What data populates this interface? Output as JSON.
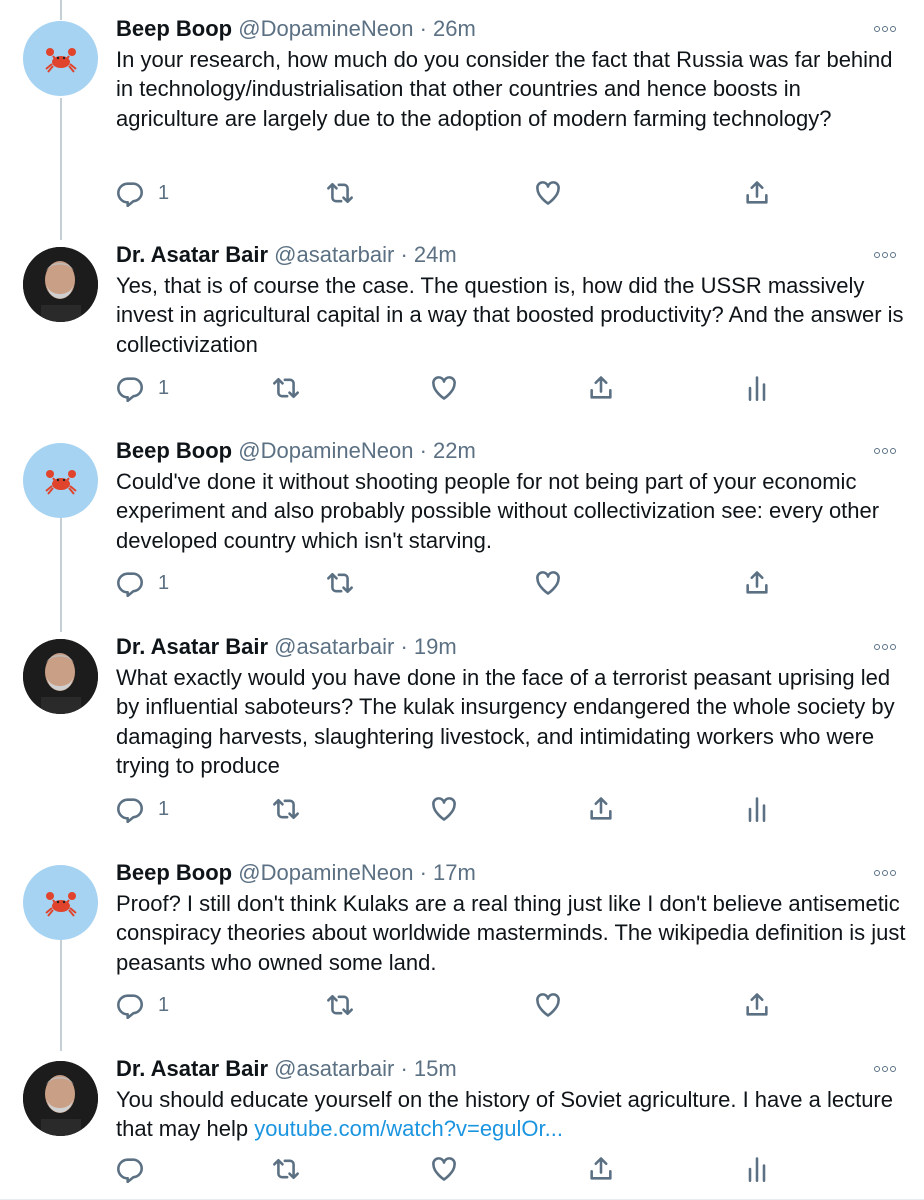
{
  "tweets": [
    {
      "name": "Beep Boop",
      "handle": "@DopamineNeon",
      "dot": "·",
      "time": "26m",
      "avatar": "crab-emoji-avatar",
      "text": "In your research, how much do you consider the fact that Russia was far behind in technology/industrialisation that other countries and hence boosts in agriculture are largely due to the adoption of modern farming technology?",
      "reply_count": "1"
    },
    {
      "name": "Dr. Asatar Bair",
      "handle": "@asatarbair",
      "dot": "·",
      "time": "24m",
      "avatar": "person-photo-avatar",
      "text": "Yes, that is of course the case. The question is, how did the USSR massively invest in agricultural capital in a way that boosted productivity? And the answer is collectivization",
      "reply_count": "1"
    },
    {
      "name": "Beep Boop",
      "handle": "@DopamineNeon",
      "dot": "·",
      "time": "22m",
      "avatar": "crab-emoji-avatar",
      "text": "Could've done it without shooting people for not being part of your economic experiment and also probably possible without collectivization see: every other developed country which isn't starving.",
      "reply_count": "1"
    },
    {
      "name": "Dr. Asatar Bair",
      "handle": "@asatarbair",
      "dot": "·",
      "time": "19m",
      "avatar": "person-photo-avatar",
      "text": "What exactly would you have done in the face of a terrorist peasant uprising led by influential saboteurs? The kulak insurgency endangered the whole society by damaging harvests, slaughtering livestock, and intimidating workers who were trying to produce",
      "reply_count": "1"
    },
    {
      "name": "Beep Boop",
      "handle": "@DopamineNeon",
      "dot": "·",
      "time": "17m",
      "avatar": "crab-emoji-avatar",
      "text": "Proof? I still don't think Kulaks are a real thing just like I don't believe antisemetic conspiracy theories about worldwide masterminds. The wikipedia definition is just peasants who owned some land.",
      "reply_count": "1"
    },
    {
      "name": "Dr. Asatar Bair",
      "handle": "@asatarbair",
      "dot": "·",
      "time": "15m",
      "avatar": "person-photo-avatar",
      "text": "You should educate yourself on the history of Soviet agriculture. I have a lecture that may help ",
      "link": "youtube.com/watch?v=egulOr...",
      "reply_count": ""
    }
  ],
  "icons": {
    "reply": "reply-icon",
    "retweet": "retweet-icon",
    "like": "like-icon",
    "share": "share-icon",
    "analytics": "analytics-icon",
    "more": "more-icon"
  },
  "colors": {
    "text": "#0f1419",
    "secondary": "#5b7083",
    "link": "#1b95e0",
    "thread_line": "#c4cfd6",
    "crab_avatar_bg": "#a6d3f2"
  }
}
